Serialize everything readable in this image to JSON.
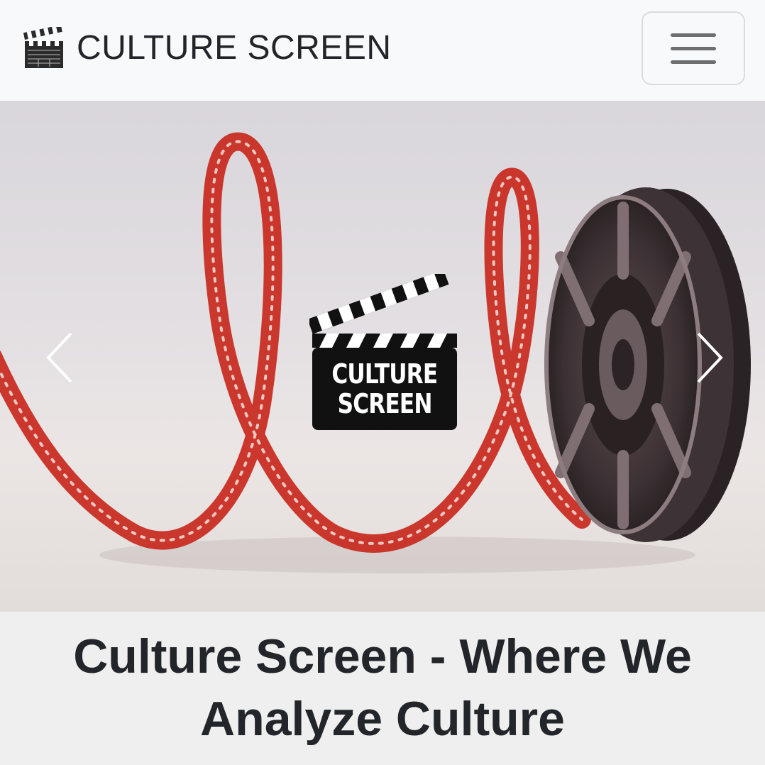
{
  "navbar": {
    "brand_text": "CULTURE SCREEN",
    "brand_icon": "clapperboard-icon",
    "menu_icon": "hamburger-menu-icon"
  },
  "hero": {
    "logo_line1": "CULTURE",
    "logo_line2": "SCREEN",
    "prev_icon": "chevron-left-icon",
    "next_icon": "chevron-right-icon"
  },
  "caption": {
    "title": "Culture Screen - Where We Analyze Culture"
  },
  "colors": {
    "navbar_bg": "#f8f9fa",
    "film_red": "#c8281c",
    "reel_dark": "#3a2f31",
    "caption_bg": "#efefef",
    "text": "#212529"
  }
}
